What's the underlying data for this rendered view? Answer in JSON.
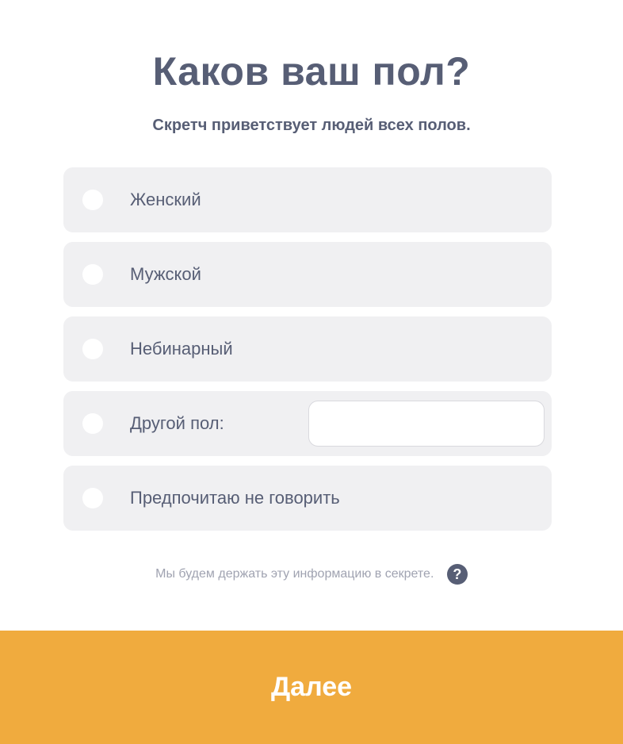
{
  "header": {
    "title": "Каков ваш пол?",
    "subtitle": "Скретч приветствует людей всех полов."
  },
  "options": [
    {
      "label": "Женский",
      "selected": false
    },
    {
      "label": "Мужской",
      "selected": false
    },
    {
      "label": "Небинарный",
      "selected": false
    },
    {
      "label": "Другой пол:",
      "selected": false,
      "input_value": ""
    },
    {
      "label": "Предпочитаю не говорить",
      "selected": false
    }
  ],
  "privacy": {
    "text": "Мы будем держать эту информацию в секрете.",
    "help_icon_glyph": "?"
  },
  "footer": {
    "next_label": "Далее"
  },
  "colors": {
    "text": "#575e75",
    "muted_text": "#a0a3b1",
    "option_background": "#f0f0f2",
    "accent": "#f0ab3e"
  }
}
